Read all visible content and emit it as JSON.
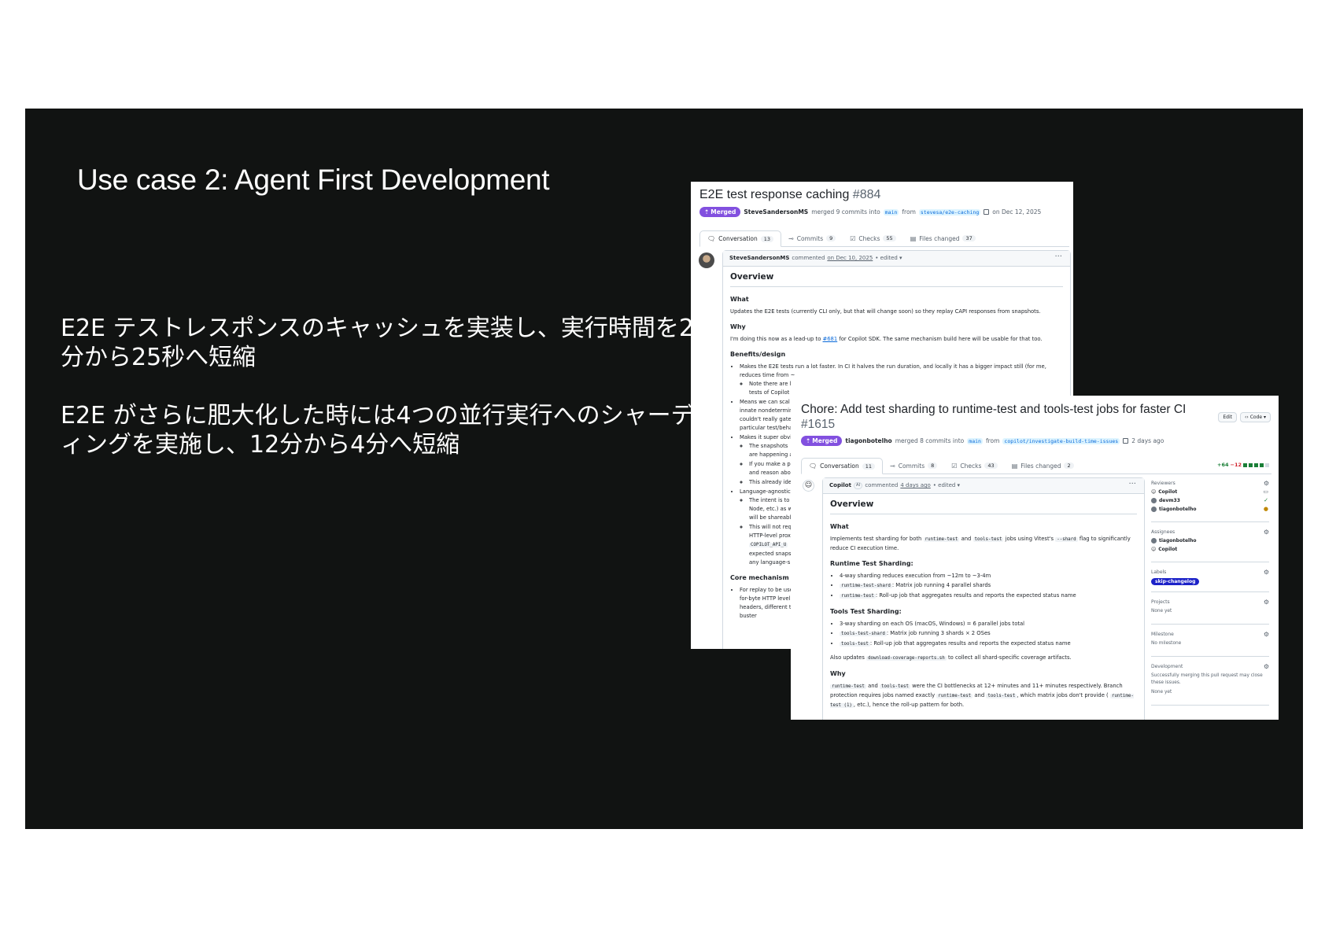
{
  "slide": {
    "title": "Use case 2: Agent First Development",
    "bullet1": "E2E テストレスポンスのキャッシュを実装し、実行時間を2分から25秒へ短縮",
    "bullet2": "E2E がさらに肥大化した時には4つの並行実行へのシャーディングを実施し、12分から4分へ短縮"
  },
  "pr1": {
    "title": "E2E test response caching",
    "number": "#884",
    "badge": "Merged",
    "author": "SteveSandersonMS",
    "merged_text": "merged 9 commits into",
    "base_branch": "main",
    "from_text": "from",
    "head_branch": "stevesa/e2e-caching",
    "date": "on Dec 12, 2025",
    "tabs": [
      {
        "label": "Conversation",
        "count": "13"
      },
      {
        "label": "Commits",
        "count": "9"
      },
      {
        "label": "Checks",
        "count": "55"
      },
      {
        "label": "Files changed",
        "count": "37"
      }
    ],
    "comment": {
      "author": "SteveSandersonMS",
      "verb": "commented",
      "date": "on Dec 10, 2025",
      "edited": "• edited ▾",
      "heading": "Overview",
      "what_h": "What",
      "what_p": "Updates the E2E tests (currently CLI only, but that will change soon) so they replay CAPI responses from snapshots.",
      "why_h": "Why",
      "why_p1": "I'm doing this now as a lead-up to",
      "why_link": "#681",
      "why_p2": "for Copilot SDK. The same mechanism build here will be usable for that too.",
      "benefits_h": "Benefits/design",
      "b1": "Makes the E2E tests run a lot faster. In CI it halves the run duration, and locally it has a bigger impact still (for me, reduces time from ~",
      "b1_sub1": "Note there are l",
      "b1_sub2": "tests of Copilot",
      "b2a": "Means we can scal",
      "b2b": "innate nondetermin",
      "b2c": "couldn't really gate",
      "b2d": "particular test/beha",
      "b3": "Makes it super obvi",
      "b3_s1a": "The snapshots",
      "b3_s1b": "are happening a",
      "b3_s2a": "If you make a pr",
      "b3_s2b": "and reason abo",
      "b3_s3": "This already ide",
      "b4": "Language-agnostic",
      "b4_s1a": "The intent is to",
      "b4_s1b": "Node, etc.) as w",
      "b4_s1c": "will be shareabl",
      "b4_s2a": "This will not req",
      "b4_s2b": "HTTP-level prox",
      "b4_s2c": "COPILOT_API_U",
      "b4_s2d": "expected snaps",
      "b4_s2e": "any language-s",
      "core_h": "Core mechanism",
      "c1a": "For replay to be use",
      "c1b": "for-byte HTTP level",
      "c1c": "headers, different t",
      "c1d": "buster"
    }
  },
  "pr2": {
    "title": "Chore: Add test sharding to runtime-test and tools-test jobs for faster CI",
    "number": "#1615",
    "badge": "Merged",
    "author": "tiagonbotelho",
    "merged_text": "merged 8 commits into",
    "base_branch": "main",
    "from_text": "from",
    "head_branch": "copilot/investigate-build-time-issues",
    "date": "2 days ago",
    "edit_btn": "Edit",
    "code_btn": "‹› Code ▾",
    "tabs": [
      {
        "label": "Conversation",
        "count": "11"
      },
      {
        "label": "Commits",
        "count": "8"
      },
      {
        "label": "Checks",
        "count": "43"
      },
      {
        "label": "Files changed",
        "count": "2"
      }
    ],
    "diff_plus": "+64",
    "diff_minus": "−12",
    "comment": {
      "author": "Copilot",
      "ai": "AI",
      "verb": "commented",
      "date": "4 days ago",
      "edited": "• edited ▾",
      "heading": "Overview",
      "what_h": "What",
      "what_p1": "Implements test sharding for both",
      "what_c1": "runtime-test",
      "what_and": "and",
      "what_c2": "tools-test",
      "what_p2": "jobs using Vitest's",
      "what_c3": "--shard",
      "what_p3": "flag to significantly reduce CI execution time.",
      "rts_h": "Runtime Test Sharding:",
      "rts1": "4-way sharding reduces execution from ~12m to ~3-4m",
      "rts2_c": "runtime-test-shard",
      "rts2": ": Matrix job running 4 parallel shards",
      "rts3_c": "runtime-test",
      "rts3": ": Roll-up job that aggregates results and reports the expected status name",
      "tts_h": "Tools Test Sharding:",
      "tts1": "3-way sharding on each OS (macOS, Windows) = 6 parallel jobs total",
      "tts2_c": "tools-test-shard",
      "tts2": ": Matrix job running 3 shards × 2 OSes",
      "tts3_c": "tools-test",
      "tts3": ": Roll-up job that aggregates results and reports the expected status name",
      "also1": "Also updates",
      "also_c": "download-coverage-reports.sh",
      "also2": "to collect all shard-specific coverage artifacts.",
      "why_h": "Why",
      "why_c1": "runtime-test",
      "why_and": "and",
      "why_c2": "tools-test",
      "why_p1": "were the CI bottlenecks at 12+ minutes and 11+ minutes respectively. Branch protection requires jobs named exactly",
      "why_c3": "runtime-test",
      "why_and2": "and",
      "why_c4": "tools-test",
      "why_p2": ", which matrix jobs don't provide (",
      "why_c5": "runtime-test (1)",
      "why_p3": ", etc.), hence the roll-up pattern for both."
    },
    "sidebar": {
      "reviewers_h": "Reviewers",
      "reviewers": [
        "Copilot",
        "devm33",
        "tiagonbotelho"
      ],
      "assignees_h": "Assignees",
      "assignees": [
        "tiagonbotelho",
        "Copilot"
      ],
      "labels_h": "Labels",
      "label": "skip-changelog",
      "projects_h": "Projects",
      "projects_v": "None yet",
      "milestone_h": "Milestone",
      "milestone_v": "No milestone",
      "development_h": "Development",
      "development_p": "Successfully merging this pull request may close these issues.",
      "development_v": "None yet"
    }
  }
}
